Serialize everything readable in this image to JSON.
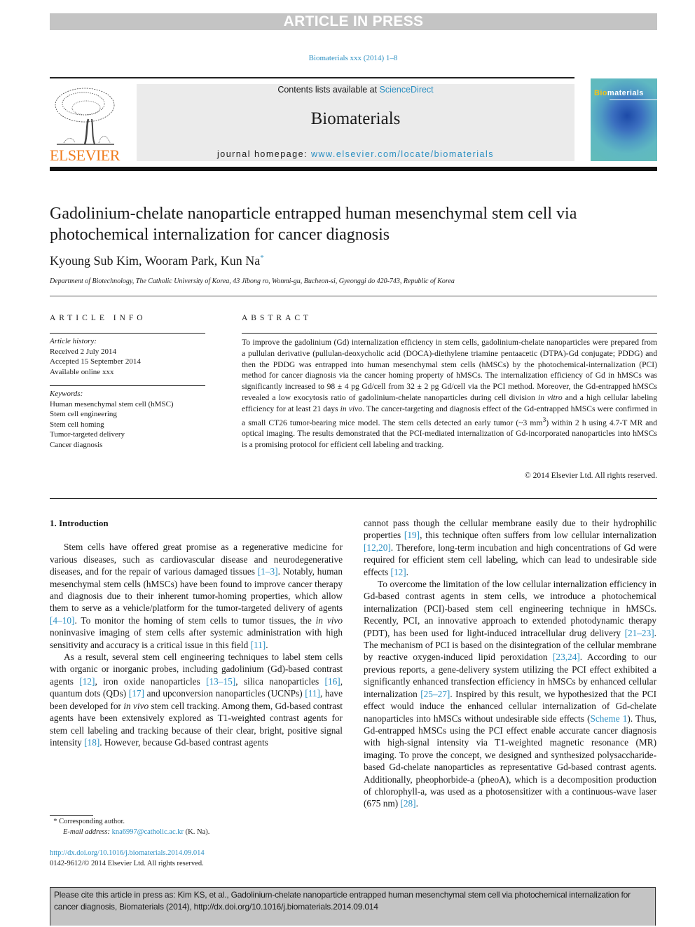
{
  "banner": "ARTICLE IN PRESS",
  "journal_ref": "Biomaterials xxx (2014) 1–8",
  "header": {
    "contents_prefix": "Contents lists available at ",
    "contents_link": "ScienceDirect",
    "journal_name": "Biomaterials",
    "homepage_prefix": "journal homepage: ",
    "homepage_link": "www.elsevier.com/locate/biomaterials",
    "publisher_logo_text": "ELSEVIER",
    "cover_title_accent": "Bio",
    "cover_title_rest": "materials"
  },
  "article": {
    "title": "Gadolinium-chelate nanoparticle entrapped human mesenchymal stem cell via photochemical internalization for cancer diagnosis",
    "authors": "Kyoung Sub Kim, Wooram Park, Kun Na",
    "author_mark": "*",
    "affiliation": "Department of Biotechnology, The Catholic University of Korea, 43 Jibong ro, Wonmi-gu, Bucheon-si, Gyeonggi do 420-743, Republic of Korea"
  },
  "article_info": {
    "heading": "ARTICLE INFO",
    "history_label": "Article history:",
    "history": [
      "Received 2 July 2014",
      "Accepted 15 September 2014",
      "Available online xxx"
    ],
    "keywords_label": "Keywords:",
    "keywords": [
      "Human mesenchymal stem cell (hMSC)",
      "Stem cell engineering",
      "Stem cell homing",
      "Tumor-targeted delivery",
      "Cancer diagnosis"
    ]
  },
  "abstract": {
    "heading": "ABSTRACT",
    "p1": "To improve the gadolinium (Gd) internalization efficiency in stem cells, gadolinium-chelate nanoparticles were prepared from a pullulan derivative (pullulan-deoxycholic acid (DOCA)-diethylene triamine pentaacetic (DTPA)-Gd conjugate; PDDG) and then the PDDG was entrapped into human mesenchymal stem cells (hMSCs) by the photochemical-internalization (PCI) method for cancer diagnosis via the cancer homing property of hMSCs. The internalization efficiency of Gd in hMSCs was significantly increased to 98 ± 4 pg Gd/cell from 32 ± 2 pg Gd/cell via the PCI method. Moreover, the Gd-entrapped hMSCs revealed a low exocytosis ratio of gadolinium-chelate nanoparticles during cell division ",
    "in_vitro": "in vitro",
    "p2": " and a high cellular labeling efficiency for at least 21 days ",
    "in_vivo": "in vivo",
    "p3": ". The cancer-targeting and diagnosis effect of the Gd-entrapped hMSCs were confirmed in a small CT26 tumor-bearing mice model. The stem cells detected an early tumor (~3 mm",
    "sup3": "3",
    "p4": ") within 2 h using 4.7-T MR and optical imaging. The results demonstrated that the PCI-mediated internalization of Gd-incorporated nanoparticles into hMSCs is a promising protocol for efficient cell labeling and tracking.",
    "copyright": "© 2014 Elsevier Ltd. All rights reserved."
  },
  "body": {
    "section_heading": "1.  Introduction",
    "col1_p1": [
      {
        "t": "Stem cells have offered great promise as a regenerative medicine for various diseases, such as cardiovascular disease and neurodegenerative diseases, and for the repair of various damaged tissues "
      },
      {
        "ref": "[1–3]"
      },
      {
        "t": ". Notably, human mesenchymal stem cells (hMSCs) have been found to improve cancer therapy and diagnosis due to their inherent tumor-homing properties, which allow them to serve as a vehicle/platform for the tumor-targeted delivery of agents "
      },
      {
        "ref": "[4–10]"
      },
      {
        "t": ". To monitor the homing of stem cells to tumor tissues, the "
      },
      {
        "i": "in vivo"
      },
      {
        "t": " noninvasive imaging of stem cells after systemic administration with high sensitivity and accuracy is a critical issue in this field "
      },
      {
        "ref": "[11]"
      },
      {
        "t": "."
      }
    ],
    "col1_p2": [
      {
        "t": "As a result, several stem cell engineering techniques to label stem cells with organic or inorganic probes, including gadolinium (Gd)-based contrast agents "
      },
      {
        "ref": "[12]"
      },
      {
        "t": ", iron oxide nanoparticles "
      },
      {
        "ref": "[13–15]"
      },
      {
        "t": ", silica nanoparticles "
      },
      {
        "ref": "[16]"
      },
      {
        "t": ", quantum dots (QDs) "
      },
      {
        "ref": "[17]"
      },
      {
        "t": " and upconversion nanoparticles (UCNPs) "
      },
      {
        "ref": "[11]"
      },
      {
        "t": ", have been developed for "
      },
      {
        "i": "in vivo"
      },
      {
        "t": " stem cell tracking. Among them, Gd-based contrast agents have been extensively explored as T1-weighted contrast agents for stem cell labeling and tracking because of their clear, bright, positive signal intensity "
      },
      {
        "ref": "[18]"
      },
      {
        "t": ". However, because Gd-based contrast agents"
      }
    ],
    "col2_p1": [
      {
        "t": "cannot pass though the cellular membrane easily due to their hydrophilic properties "
      },
      {
        "ref": "[19]"
      },
      {
        "t": ", this technique often suffers from low cellular internalization "
      },
      {
        "ref": "[12,20]"
      },
      {
        "t": ". Therefore, long-term incubation and high concentrations of Gd were required for efficient stem cell labeling, which can lead to undesirable side effects "
      },
      {
        "ref": "[12]"
      },
      {
        "t": "."
      }
    ],
    "col2_p2": [
      {
        "t": "To overcome the limitation of the low cellular internalization efficiency in Gd-based contrast agents in stem cells, we introduce a photochemical internalization (PCI)-based stem cell engineering technique in hMSCs. Recently, PCI, an innovative approach to extended photodynamic therapy (PDT), has been used for light-induced intracellular drug delivery "
      },
      {
        "ref": "[21–23]"
      },
      {
        "t": ". The mechanism of PCI is based on the disintegration of the cellular membrane by reactive oxygen-induced lipid peroxidation "
      },
      {
        "ref": "[23,24]"
      },
      {
        "t": ". According to our previous reports, a gene-delivery system utilizing the PCI effect exhibited a significantly enhanced transfection efficiency in hMSCs by enhanced cellular internalization "
      },
      {
        "ref": "[25–27]"
      },
      {
        "t": ". Inspired by this result, we hypothesized that the PCI effect would induce the enhanced cellular internalization of Gd-chelate nanoparticles into hMSCs without undesirable side effects ("
      },
      {
        "ref": "Scheme 1"
      },
      {
        "t": "). Thus, Gd-entrapped hMSCs using the PCI effect enable accurate cancer diagnosis with high-signal intensity via T1-weighted magnetic resonance (MR) imaging. To prove the concept, we designed and synthesized polysaccharide-based Gd-chelate nanoparticles as representative Gd-based contrast agents. Additionally, pheophorbide-a (pheoA), which is a decomposition production of chlorophyll-a, was used as a photosensitizer with a continuous-wave laser (675 nm) "
      },
      {
        "ref": "[28]"
      },
      {
        "t": "."
      }
    ]
  },
  "footnote": {
    "mark": "*",
    "corresponding": "Corresponding author.",
    "email_label": "E-mail address:",
    "email": "kna6997@catholic.ac.kr",
    "email_suffix": " (K. Na)."
  },
  "doi": {
    "link": "http://dx.doi.org/10.1016/j.biomaterials.2014.09.014",
    "issn_copyright": "0142-9612/© 2014 Elsevier Ltd. All rights reserved."
  },
  "citation_box": "Please cite this article in press as: Kim KS, et al., Gadolinium-chelate nanoparticle entrapped human mesenchymal stem cell via photochemical internalization for cancer diagnosis, Biomaterials (2014), http://dx.doi.org/10.1016/j.biomaterials.2014.09.014",
  "colors": {
    "link": "#2b8fc2",
    "elsevier_orange": "#f07c1c",
    "banner_gray": "#c4c4c4"
  }
}
